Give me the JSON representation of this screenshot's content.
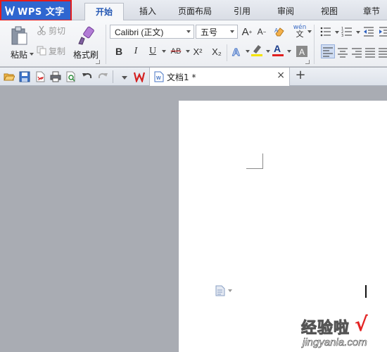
{
  "app": {
    "title": "WPS 文字",
    "brand_color": "#2f66d0",
    "highlight_color": "#e51b1b"
  },
  "menu_tabs": [
    {
      "label": "开始",
      "active": true
    },
    {
      "label": "插入",
      "active": false
    },
    {
      "label": "页面布局",
      "active": false
    },
    {
      "label": "引用",
      "active": false
    },
    {
      "label": "审阅",
      "active": false
    },
    {
      "label": "视图",
      "active": false
    },
    {
      "label": "章节",
      "active": false
    }
  ],
  "clipboard": {
    "paste_label": "粘贴",
    "cut_label": "剪切",
    "copy_label": "复制",
    "format_painter_label": "格式刷"
  },
  "font": {
    "name": "Calibri (正文)",
    "size": "五号"
  },
  "font_buttons": {
    "bold": "B",
    "italic": "I",
    "underline": "U",
    "strike": "AB",
    "superscript": "X²",
    "subscript": "X₂",
    "grow": "A",
    "shrink": "A",
    "phonetic": "wén",
    "phonetic_char": "文"
  },
  "quick_access": {
    "icons": [
      "open-folder-icon",
      "save-icon",
      "export-pdf-icon",
      "print-icon",
      "print-preview-icon",
      "undo-icon",
      "redo-icon"
    ]
  },
  "document_tab": {
    "label": "文档1 *",
    "close": "×",
    "new_tab": "+"
  },
  "watermark": {
    "text": "经验啦",
    "check": "√",
    "url": "jingyanla.com"
  },
  "colors": {
    "active_tab_text": "#2457b3",
    "workspace": "#a9acb3",
    "page": "#ffffff",
    "font_color_bar": "#e02020",
    "highlight_bar": "#f5e400"
  }
}
